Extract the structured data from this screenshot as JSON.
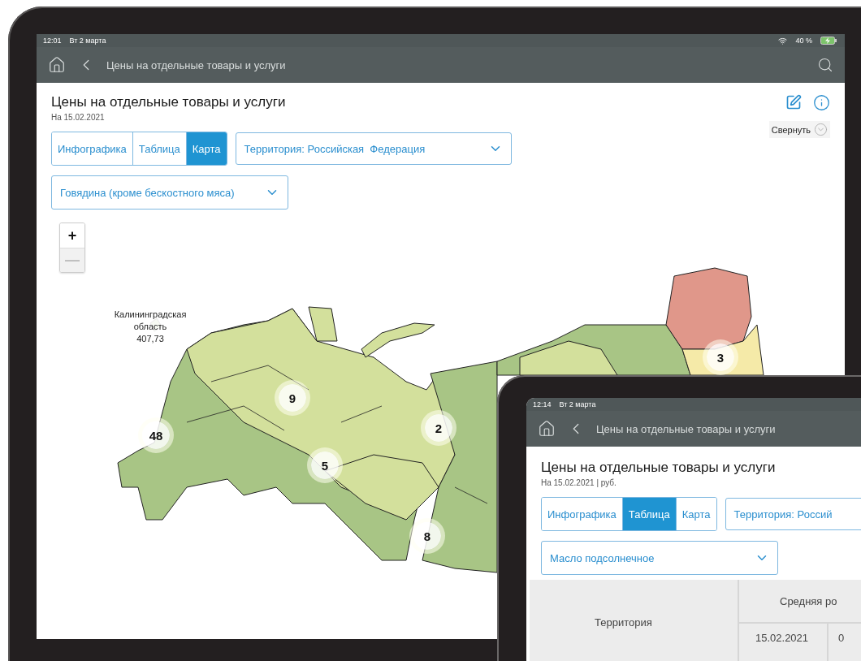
{
  "tablet_main": {
    "status_bar": {
      "time": "12:01",
      "date": "Вт 2 марта",
      "battery": "40 %"
    },
    "nav_bar": {
      "title": "Цены на отдельные товары и услуги"
    },
    "page": {
      "title": "Цены на отдельные товары и услуги",
      "subtitle": "На 15.02.2021",
      "collapse_button": "Свернуть",
      "view_tabs": [
        {
          "label": "Инфографика",
          "selected": false
        },
        {
          "label": "Таблица",
          "selected": false
        },
        {
          "label": "Карта",
          "selected": true
        }
      ],
      "territory_select": {
        "value": "Территория: Российская  Федерация"
      },
      "product_select": {
        "value": "Говядина (кроме бескостного мяса)"
      },
      "zoom_controls": [
        {
          "label": "+",
          "disabled": false
        },
        {
          "label": "—",
          "disabled": true
        }
      ],
      "map": {
        "region_label": {
          "name": "Калининградская область",
          "value": "407,73"
        },
        "clusters": [
          {
            "count": "48"
          },
          {
            "count": "9"
          },
          {
            "count": "5"
          },
          {
            "count": "2"
          },
          {
            "count": "8"
          },
          {
            "count": "3"
          }
        ]
      }
    }
  },
  "tablet_second": {
    "status_bar": {
      "time": "12:14",
      "date": "Вт 2 марта"
    },
    "nav_bar": {
      "title": "Цены на отдельные товары и услуги"
    },
    "page": {
      "title": "Цены на отдельные товары и услуги",
      "subtitle": "На 15.02.2021 | руб.",
      "view_tabs": [
        {
          "label": "Инфографика",
          "selected": false
        },
        {
          "label": "Таблица",
          "selected": true
        },
        {
          "label": "Карта",
          "selected": false
        }
      ],
      "territory_select": {
        "value": "Территория: Россий"
      },
      "product_select": {
        "value": "Масло подсолнечное"
      },
      "table": {
        "columns": [
          "Территория",
          "Средняя ро"
        ],
        "subcolumns": [
          "15.02.2021",
          "0"
        ]
      }
    }
  }
}
